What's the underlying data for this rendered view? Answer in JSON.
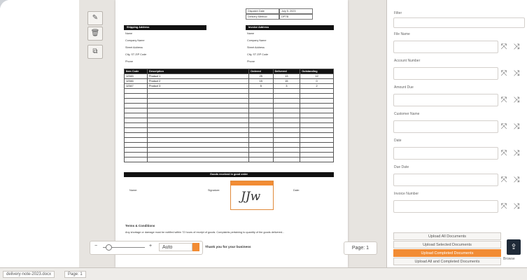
{
  "viewer": {
    "doc_header": {
      "dispatch_label": "Dispatch Date",
      "dispatch_value": "July 5, 2023",
      "delivery_label": "Delivery Method",
      "delivery_value": "DPTB"
    },
    "shipping": {
      "title": "Shipping Address",
      "lines": [
        "Name",
        "Company Name",
        "Street Address",
        "City, ST ZIP Code",
        "Phone"
      ]
    },
    "invoice": {
      "title": "Invoice Address",
      "lines": [
        "Name",
        "Company Name",
        "Street Address",
        "City, ST ZIP Code",
        "Phone"
      ]
    },
    "items_table": {
      "headers": [
        "Item Code",
        "Description",
        "Ordered",
        "Delivered",
        "Outstanding"
      ],
      "rows": [
        [
          "12345",
          "Product 1",
          "25",
          "13",
          "12"
        ],
        [
          "12346",
          "Product 2",
          "15",
          "15",
          "0"
        ],
        [
          "12347",
          "Product 3",
          "5",
          "3",
          "2"
        ]
      ]
    },
    "goods_received_title": "Goods received in good order",
    "sig_labels": {
      "name": "Name:",
      "signature": "Signature:",
      "date": "Date:"
    },
    "signature_text": "JJw",
    "terms_title": "Terms & Conditions",
    "terms_text": "Any shortage or damage must be notified within 72 hours of receipt of goods. Complaints pertaining to quantity of the goods delivered...",
    "thanks": "Thank you for your business",
    "zoom": {
      "minus": "−",
      "plus": "+",
      "value": "Auto"
    },
    "page_indicator": "Page: 1",
    "tools": [
      {
        "name": "pen-icon",
        "glyph": "✎"
      },
      {
        "name": "trash-icon",
        "glyph": "🗑"
      },
      {
        "name": "copy-icon",
        "glyph": "⧉"
      }
    ]
  },
  "panel": {
    "filter_label": "Filter",
    "fields": [
      {
        "label": "File Name"
      },
      {
        "label": "Account Number"
      },
      {
        "label": "Amount Due"
      },
      {
        "label": "Customer Name"
      },
      {
        "label": "Date"
      },
      {
        "label": "Due Date"
      },
      {
        "label": "Invoice Number"
      }
    ],
    "buttons": [
      {
        "label": "Upload All Documents",
        "style": "plain"
      },
      {
        "label": "Upload Selected Documents",
        "style": "plain"
      },
      {
        "label": "Upload Completed Documents",
        "style": "orange"
      },
      {
        "label": "Upload All and Completed Documents",
        "style": "plain"
      }
    ],
    "upload_caption": "Browse",
    "accent": "#f28c34"
  },
  "status": {
    "tabs": [
      "delivery-note-2023.docx",
      "Page: 1"
    ]
  }
}
